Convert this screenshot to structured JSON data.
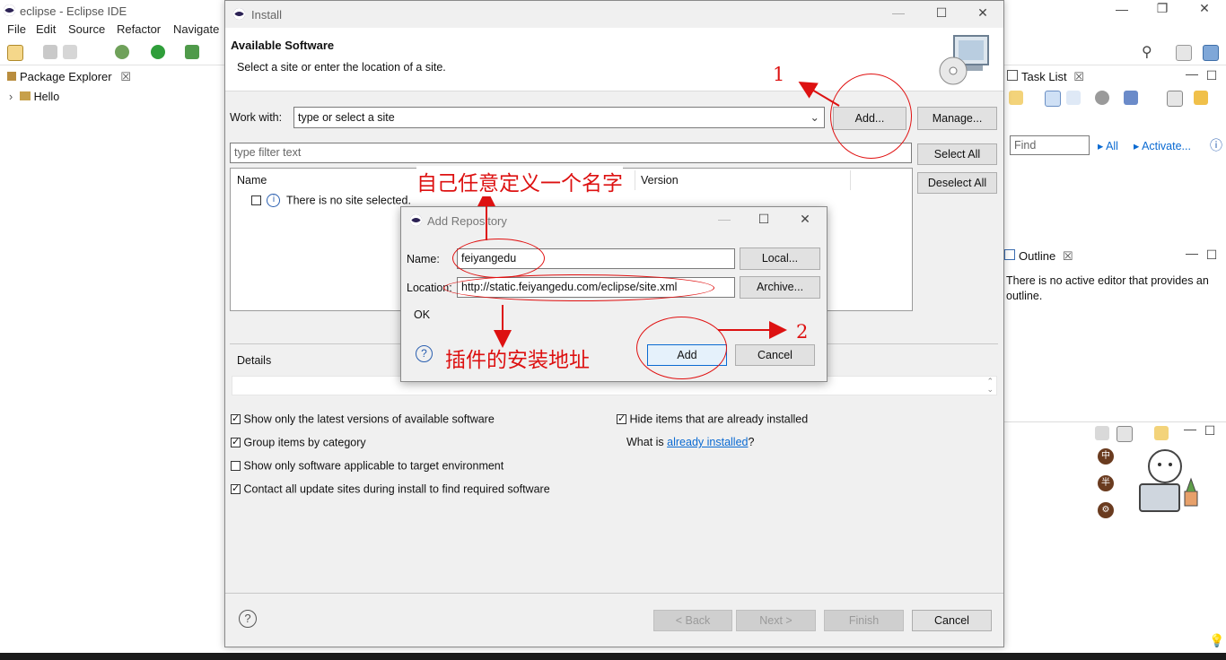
{
  "window": {
    "title": "eclipse - Eclipse IDE"
  },
  "menu": {
    "items": [
      "File",
      "Edit",
      "Source",
      "Refactor",
      "Navigate"
    ]
  },
  "package_explorer": {
    "tab": "Package Explorer",
    "tree": [
      "Hello"
    ]
  },
  "task_list": {
    "tab": "Task List",
    "find_placeholder": "Find",
    "all_label": "All",
    "activate_label": "Activate..."
  },
  "outline": {
    "tab": "Outline",
    "message": "There is no active editor that provides an outline."
  },
  "install": {
    "title": "Install",
    "heading": "Available Software",
    "subheading": "Select a site or enter the location of a site.",
    "work_with_label": "Work with:",
    "work_with_placeholder": "type or select a site",
    "add_button": "Add...",
    "manage_button": "Manage...",
    "filter_placeholder": "type filter text",
    "select_all": "Select All",
    "deselect_all": "Deselect All",
    "col_name": "Name",
    "col_version": "Version",
    "no_site": "There is no site selected.",
    "details_label": "Details",
    "options": [
      {
        "label": "Show only the latest versions of available software",
        "checked": true
      },
      {
        "label": "Group items by category",
        "checked": true
      },
      {
        "label": "Show only software applicable to target environment",
        "checked": false
      },
      {
        "label": "Contact all update sites during install to find required software",
        "checked": true
      }
    ],
    "hide_installed": {
      "label": "Hide items that are already installed",
      "checked": true
    },
    "what_is_prefix": "What is ",
    "what_is_link": "already installed",
    "what_is_suffix": "?",
    "back": "< Back",
    "next": "Next >",
    "finish": "Finish",
    "cancel": "Cancel"
  },
  "add_repository": {
    "title": "Add Repository",
    "name_label": "Name:",
    "name_value": "feiyangedu",
    "location_label": "Location:",
    "location_value": "http://static.feiyangedu.com/eclipse/site.xml",
    "local_button": "Local...",
    "archive_button": "Archive...",
    "status": "OK",
    "add_button": "Add",
    "cancel_button": "Cancel"
  },
  "annotations": {
    "step1": "1",
    "step2": "2",
    "name_hint": "自己任意定义一个名字",
    "location_hint": "插件的安装地址"
  },
  "colors": {
    "annotation_red": "#dd1111",
    "accent_blue": "#0a6ad2",
    "eclipse_purple": "#2c2255"
  }
}
